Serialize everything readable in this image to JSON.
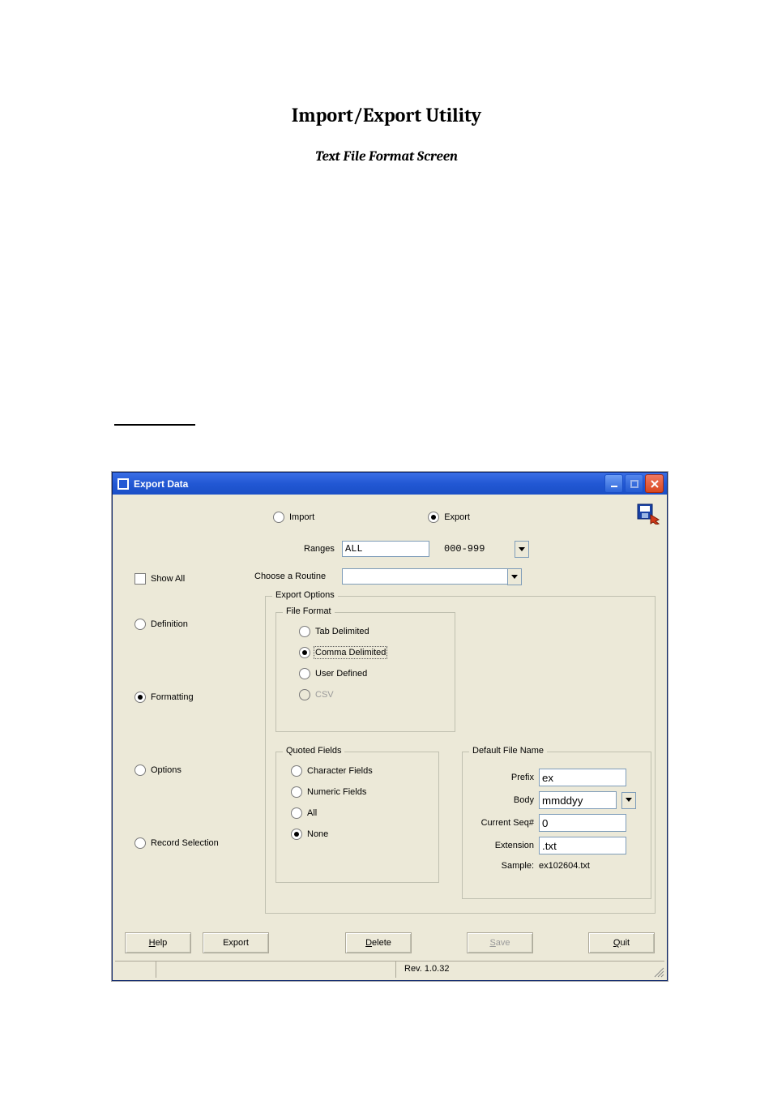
{
  "document": {
    "title": "Import/Export Utility",
    "subtitle": "Text File Format Screen"
  },
  "window": {
    "title": "Export Data"
  },
  "mode": {
    "import_label": "Import",
    "export_label": "Export",
    "selected": "Export"
  },
  "ranges": {
    "label": "Ranges",
    "value": "ALL",
    "range_label": "000-999"
  },
  "routine": {
    "label": "Choose a Routine",
    "value": ""
  },
  "show_all": {
    "label": "Show All",
    "checked": false
  },
  "left_tabs": {
    "definition": "Definition",
    "formatting": "Formatting",
    "options": "Options",
    "record_selection": "Record Selection",
    "selected": "Formatting"
  },
  "export_options": {
    "legend": "Export Options"
  },
  "file_format": {
    "legend": "File Format",
    "tab": "Tab Delimited",
    "comma": "Comma Delimited",
    "user": "User Defined",
    "csv": "CSV",
    "selected": "Comma Delimited"
  },
  "quoted_fields": {
    "legend": "Quoted Fields",
    "character": "Character Fields",
    "numeric": "Numeric Fields",
    "all": "All",
    "none": "None",
    "selected": "None"
  },
  "default_filename": {
    "legend": "Default File Name",
    "prefix_label": "Prefix",
    "prefix_value": "ex",
    "body_label": "Body",
    "body_value": "mmddyy",
    "seq_label": "Current Seq#",
    "seq_value": "0",
    "ext_label": "Extension",
    "ext_value": ".txt",
    "sample_label": "Sample:",
    "sample_value": "ex102604.txt"
  },
  "buttons": {
    "help": "Help",
    "export": "Export",
    "delete": "Delete",
    "save": "Save",
    "quit": "Quit"
  },
  "status": {
    "revision": "Rev. 1.0.32"
  }
}
